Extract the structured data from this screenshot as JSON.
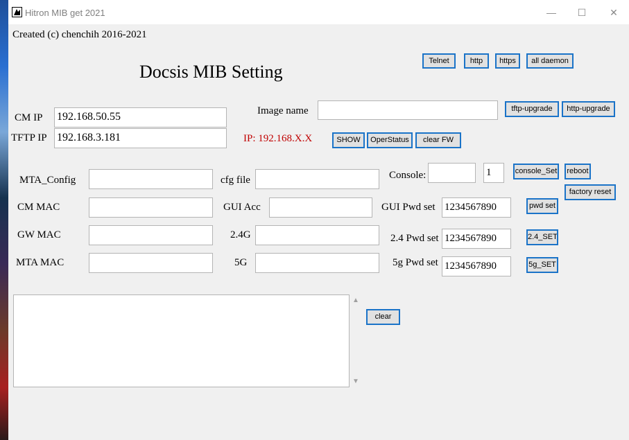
{
  "window": {
    "title": "Hitron MIB get 2021",
    "minimize": "—",
    "maximize": "☐",
    "close": "✕"
  },
  "credit": "Created (c) chenchih 2016-2021",
  "heading": "Docsis MIB Setting",
  "top_buttons": {
    "telnet": "Telnet",
    "http": "http",
    "https": "https",
    "all_daemon": "all daemon"
  },
  "cm_ip": {
    "label": "CM IP",
    "value": "192.168.50.55"
  },
  "tftp_ip": {
    "label": "TFTP IP",
    "value": "192.168.3.181"
  },
  "ip_hint": {
    "text": "IP: 192.168.X.X",
    "color": "#c00000"
  },
  "image_name": {
    "label": "Image name",
    "value": ""
  },
  "upgrade_buttons": {
    "tftp": "tftp-upgrade",
    "http": "http-upgrade"
  },
  "fw_buttons": {
    "show": "SHOW",
    "operstatus": "OperStatus",
    "clear_fw": "clear FW"
  },
  "mta_config": {
    "label": "MTA_Config",
    "value": ""
  },
  "cfg_file": {
    "label": "cfg file",
    "value": ""
  },
  "console": {
    "label": "Console:",
    "value": "",
    "number": "1",
    "set_button": "console_Set"
  },
  "reboot_button": "reboot",
  "factory_reset_button": "factory reset",
  "cm_mac": {
    "label": "CM MAC",
    "value": ""
  },
  "gui_acc": {
    "label": "GUI Acc",
    "value": ""
  },
  "gui_pwd": {
    "label": "GUI Pwd set",
    "value": "1234567890",
    "button": "pwd set"
  },
  "gw_mac": {
    "label": "GW MAC",
    "value": ""
  },
  "wifi_24g": {
    "label": "2.4G",
    "value": ""
  },
  "pwd_24": {
    "label": "2.4 Pwd set",
    "value": "1234567890",
    "button": "2.4_SET"
  },
  "mta_mac": {
    "label": "MTA MAC",
    "value": ""
  },
  "wifi_5g": {
    "label": "5G",
    "value": ""
  },
  "pwd_5g": {
    "label": "5g Pwd set",
    "value": "1234567890",
    "button": "5g_SET"
  },
  "output": {
    "value": ""
  },
  "clear_button": "clear",
  "icons": {
    "scroll_up": "▲",
    "scroll_down": "▼"
  },
  "colors": {
    "button_border": "#1a73c8",
    "button_bg": "#e1e1e1",
    "hint": "#c00000"
  }
}
